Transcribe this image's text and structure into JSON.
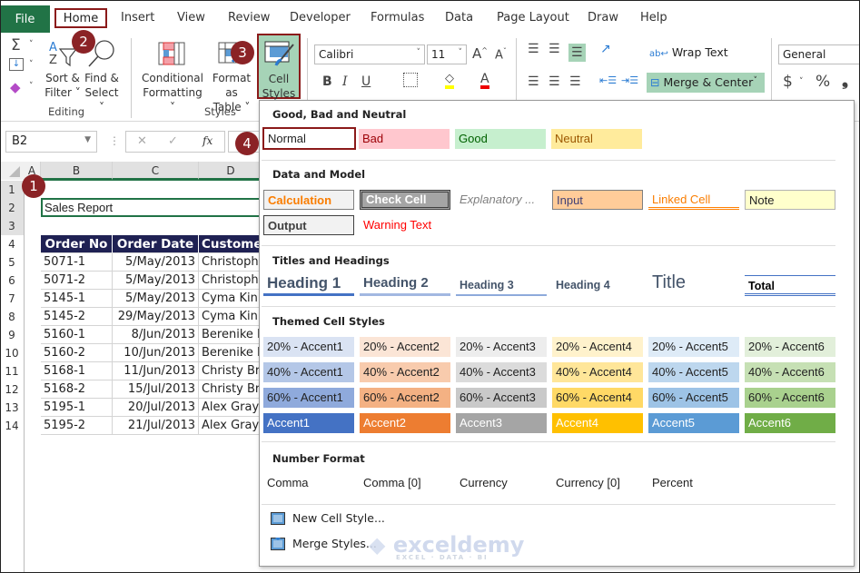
{
  "tabs": {
    "file": "File",
    "items": [
      "Home",
      "Insert",
      "View",
      "Review",
      "Developer",
      "Formulas",
      "Data",
      "Page Layout",
      "Draw",
      "Help"
    ],
    "active": "Home"
  },
  "ribbon": {
    "editing": {
      "label": "Editing",
      "sort_filter": [
        "Sort &",
        "Filter ˅"
      ],
      "find_select": [
        "Find &",
        "Select ˅"
      ]
    },
    "styles": {
      "label": "Styles",
      "conditional": [
        "Conditional",
        "Formatting ˅"
      ],
      "format_table": [
        "Format as",
        "Table ˅"
      ],
      "cell_styles": [
        "Cell",
        "Styles ˅"
      ]
    },
    "font": {
      "name": "Calibri",
      "size": "11",
      "bold": "B",
      "italic": "I",
      "underline": "U"
    },
    "alignment": {
      "wrap_text": "Wrap Text",
      "merge_center": "Merge & Center"
    },
    "number": {
      "format": "General",
      "currency": "$",
      "percent": "%",
      "comma": "❟"
    }
  },
  "badges": [
    "1",
    "2",
    "3",
    "4"
  ],
  "formula_bar": {
    "name_box": "B2",
    "cancel": "✕",
    "enter": "✓",
    "fx": "fx"
  },
  "sheet": {
    "columns": [
      "A",
      "B",
      "C",
      "D"
    ],
    "rows": [
      "1",
      "2",
      "3",
      "4",
      "5",
      "6",
      "7",
      "8",
      "9",
      "10",
      "11",
      "12",
      "13",
      "14"
    ],
    "title_cell": "Sales Report",
    "headers": [
      "Order No",
      "Order Date",
      "Custome"
    ],
    "data": [
      [
        "5071-1",
        "5/May/2013",
        "Christophe"
      ],
      [
        "5071-2",
        "5/May/2013",
        "Christophe"
      ],
      [
        "5145-1",
        "5/May/2013",
        "Cyma Kinn"
      ],
      [
        "5145-2",
        "29/May/2013",
        "Cyma Kinn"
      ],
      [
        "5160-1",
        "8/Jun/2013",
        "Berenike H"
      ],
      [
        "5160-2",
        "10/Jun/2013",
        "Berenike H"
      ],
      [
        "5168-1",
        "11/Jun/2013",
        "Christy Bri"
      ],
      [
        "5168-2",
        "15/Jul/2013",
        "Christy Bri"
      ],
      [
        "5195-1",
        "20/Jul/2013",
        "Alex Grays"
      ],
      [
        "5195-2",
        "21/Jul/2013",
        "Alex Grays"
      ]
    ]
  },
  "cell_styles": {
    "good_bad_neutral": {
      "title": "Good, Bad and Neutral",
      "items": [
        "Normal",
        "Bad",
        "Good",
        "Neutral"
      ]
    },
    "data_model": {
      "title": "Data and Model",
      "items": [
        "Calculation",
        "Check Cell",
        "Explanatory ...",
        "Input",
        "Linked Cell",
        "Note",
        "Output",
        "Warning Text"
      ]
    },
    "titles_headings": {
      "title": "Titles and Headings",
      "items": [
        "Heading 1",
        "Heading 2",
        "Heading 3",
        "Heading 4",
        "Title",
        "Total"
      ]
    },
    "themed": {
      "title": "Themed Cell Styles",
      "rows": [
        [
          "20% - Accent1",
          "20% - Accent2",
          "20% - Accent3",
          "20% - Accent4",
          "20% - Accent5",
          "20% - Accent6"
        ],
        [
          "40% - Accent1",
          "40% - Accent2",
          "40% - Accent3",
          "40% - Accent4",
          "40% - Accent5",
          "40% - Accent6"
        ],
        [
          "60% - Accent1",
          "60% - Accent2",
          "60% - Accent3",
          "60% - Accent4",
          "60% - Accent5",
          "60% - Accent6"
        ],
        [
          "Accent1",
          "Accent2",
          "Accent3",
          "Accent4",
          "Accent5",
          "Accent6"
        ]
      ],
      "colors": [
        [
          "#dae3f3",
          "#fbe5d6",
          "#ededed",
          "#fff2cc",
          "#deebf7",
          "#e2efda"
        ],
        [
          "#b4c7e7",
          "#f8cbad",
          "#dbdbdb",
          "#ffe699",
          "#bdd7ee",
          "#c6e0b4"
        ],
        [
          "#8faadc",
          "#f4b183",
          "#c9c9c9",
          "#ffd966",
          "#9dc3e6",
          "#a9d18e"
        ],
        [
          "#4472c4",
          "#ed7d31",
          "#a5a5a5",
          "#ffc000",
          "#5b9bd5",
          "#70ad47"
        ]
      ]
    },
    "number_format": {
      "title": "Number Format",
      "items": [
        "Comma",
        "Comma [0]",
        "Currency",
        "Currency [0]",
        "Percent"
      ]
    },
    "menu": {
      "new_style": "New Cell Style...",
      "merge_styles": "Merge Styles..."
    }
  },
  "watermark": {
    "brand": "exceldemy",
    "tagline": "EXCEL · DATA · BI"
  },
  "colors": {
    "excel_green": "#217346",
    "highlight": "#a6d3b7",
    "annotation": "#8b2326",
    "table_header": "#1f2153"
  }
}
